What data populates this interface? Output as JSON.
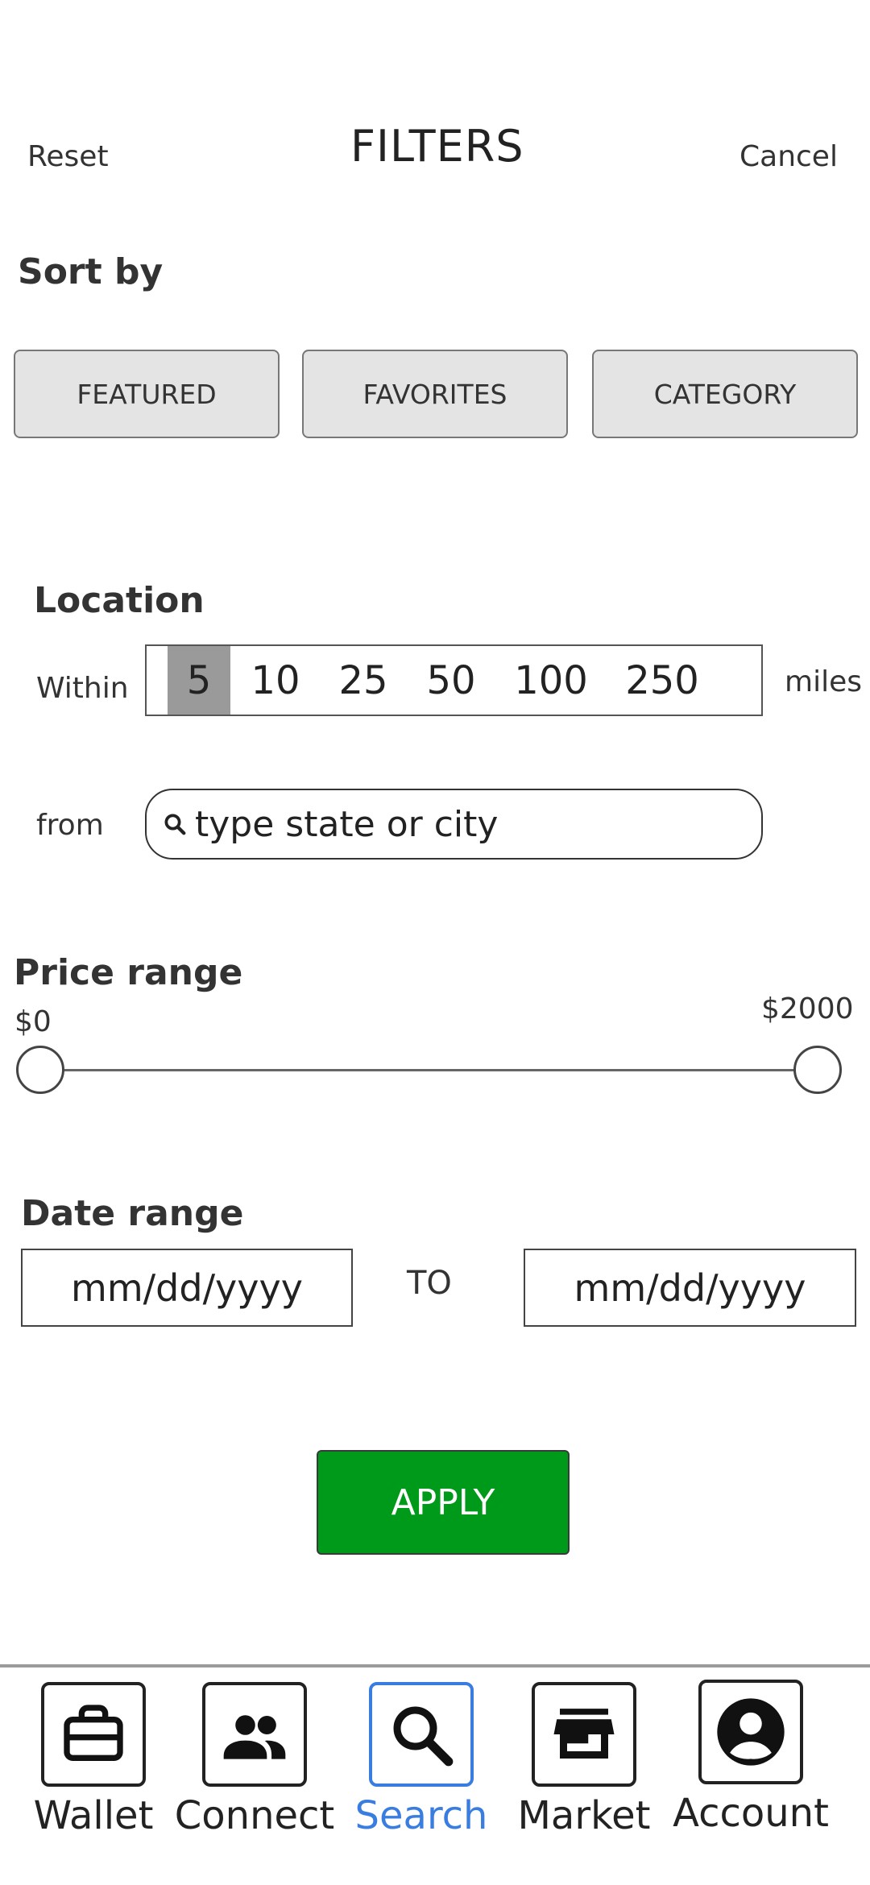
{
  "header": {
    "reset": "Reset",
    "title": "FILTERS",
    "cancel": "Cancel"
  },
  "sort": {
    "title": "Sort by",
    "options": [
      "FEATURED",
      "FAVORITES",
      "CATEGORY"
    ]
  },
  "location": {
    "title": "Location",
    "within_label": "Within",
    "miles_label": "miles",
    "distances": [
      "5",
      "10",
      "25",
      "50",
      "100",
      "250"
    ],
    "selected": "5",
    "from_label": "from",
    "search_placeholder": "type state or city"
  },
  "price": {
    "title": "Price range",
    "min_label": "$0",
    "max_label": "$2000",
    "min_value": 0,
    "max_value": 2000
  },
  "date": {
    "title": "Date range",
    "from_placeholder": "mm/dd/yyyy",
    "to_label": "TO",
    "to_placeholder": "mm/dd/yyyy"
  },
  "apply_label": "APPLY",
  "nav": {
    "items": [
      {
        "label": "Wallet",
        "icon": "briefcase-icon"
      },
      {
        "label": "Connect",
        "icon": "people-icon"
      },
      {
        "label": "Search",
        "icon": "search-icon",
        "active": true
      },
      {
        "label": "Market",
        "icon": "store-icon"
      },
      {
        "label": "Account",
        "icon": "account-circle-icon"
      }
    ]
  },
  "colors": {
    "accent": "#3a7de0",
    "apply": "#009a1a",
    "selected_segment": "#9a9a9a"
  }
}
